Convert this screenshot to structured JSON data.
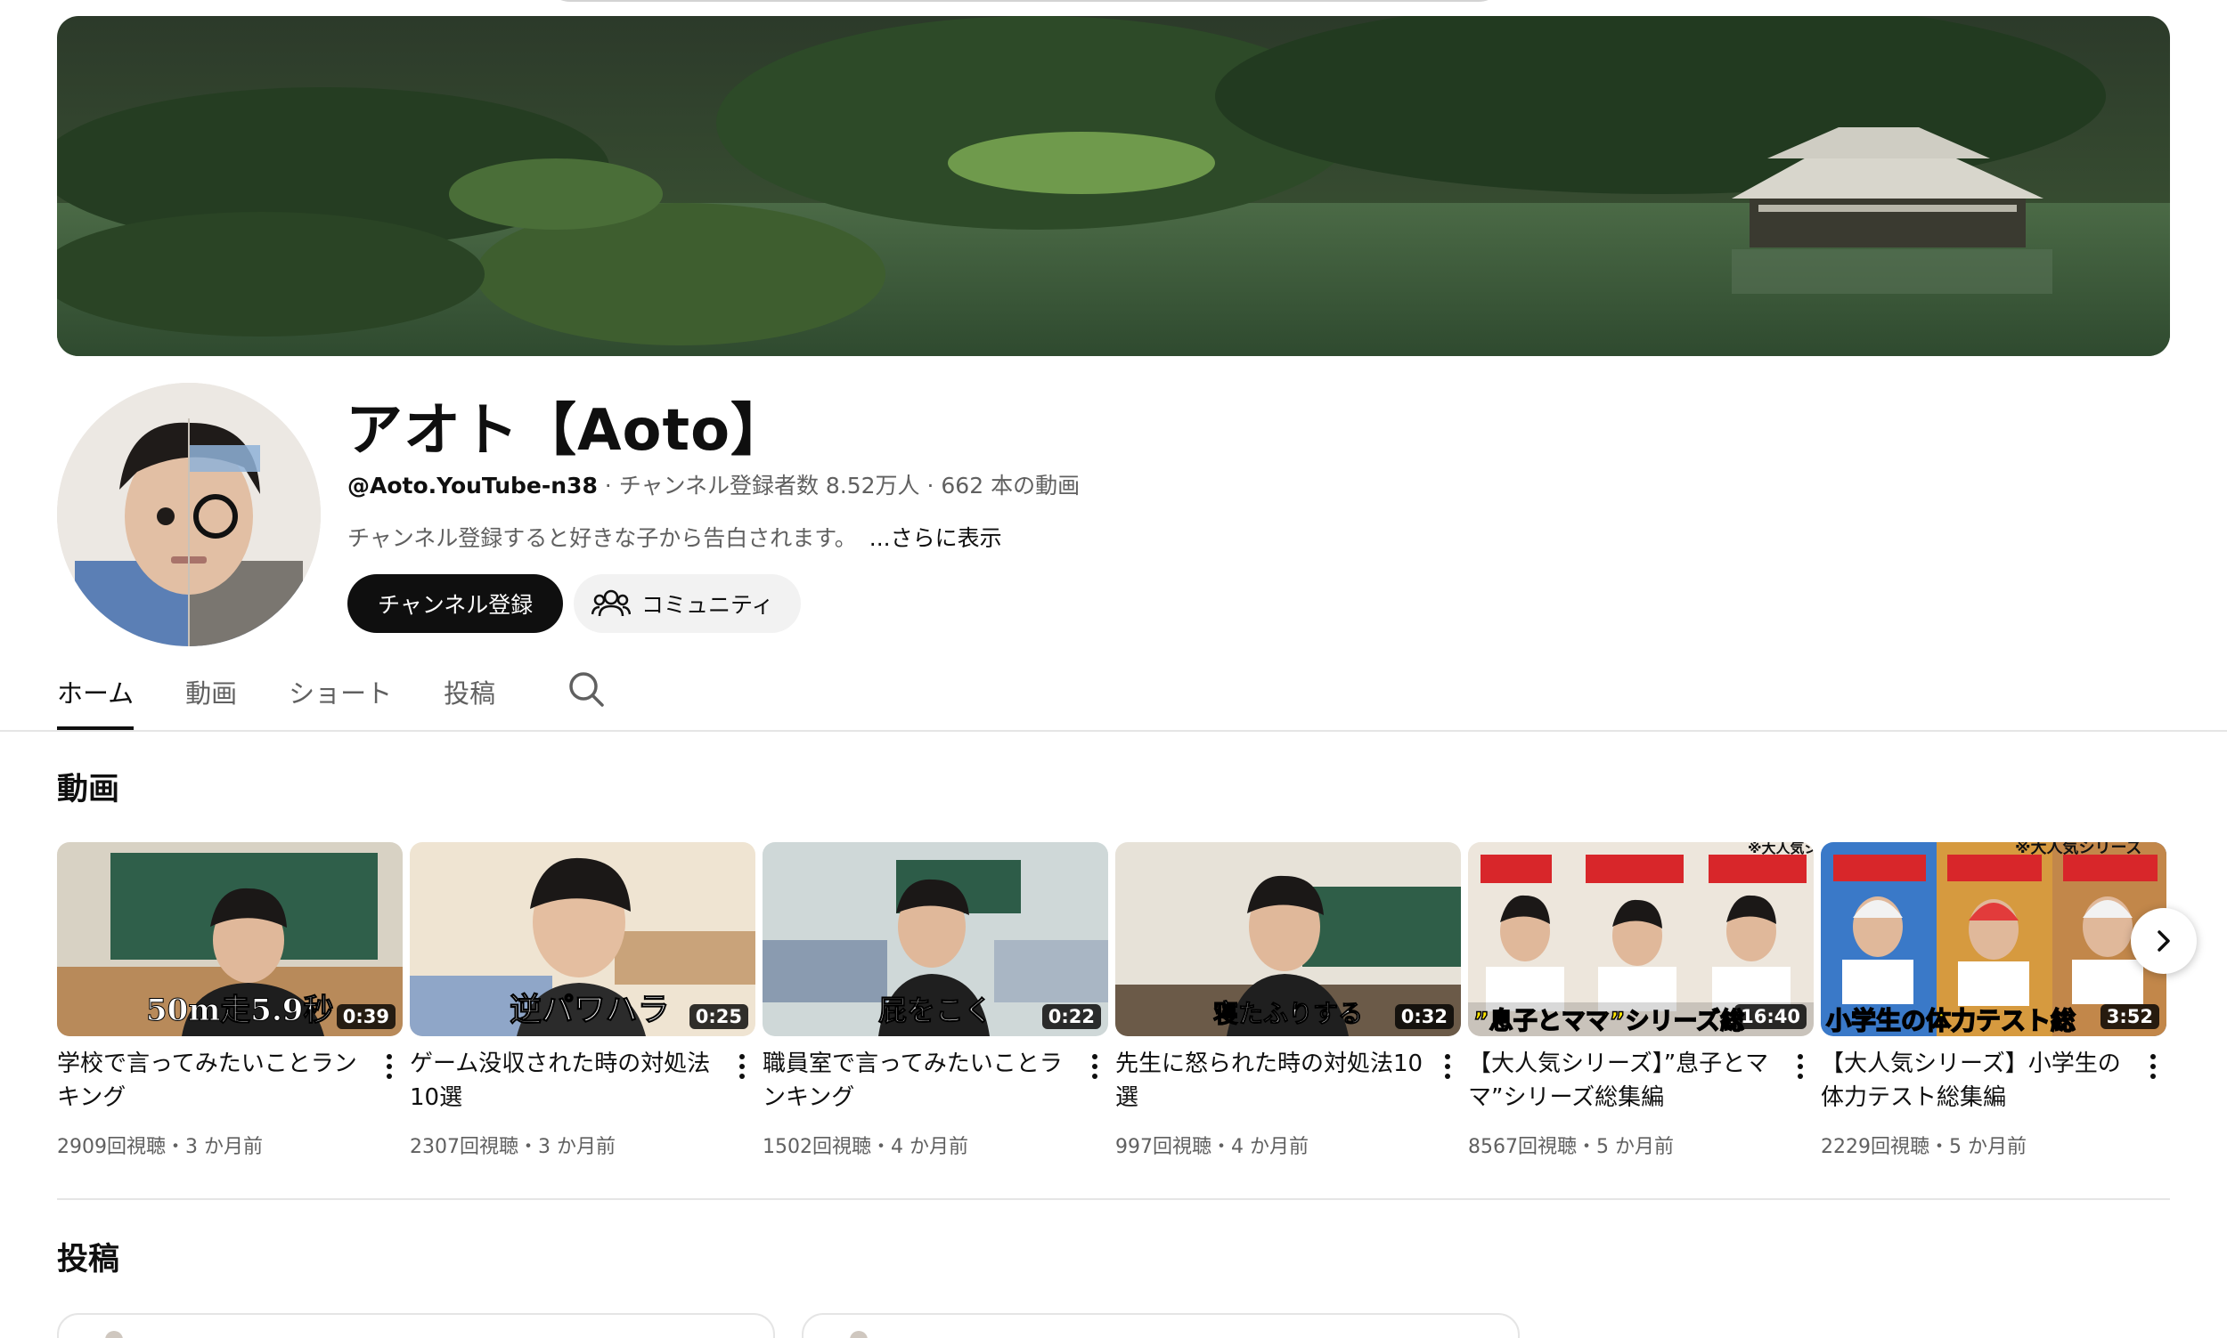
{
  "channel": {
    "name": "アオト【Aoto】",
    "handle": "@Aoto.YouTube-n38",
    "meta_rest": " · チャンネル登録者数 8.52万人 · 662 本の動画",
    "description": "チャンネル登録すると好きな子から告白されます。",
    "more_label": "...さらに表示",
    "subscribe_label": "チャンネル登録",
    "community_label": "コミュニティ"
  },
  "tabs": [
    {
      "label": "ホーム",
      "active": true
    },
    {
      "label": "動画",
      "active": false
    },
    {
      "label": "ショート",
      "active": false
    },
    {
      "label": "投稿",
      "active": false
    }
  ],
  "sections": {
    "videos_title": "動画",
    "posts_title": "投稿"
  },
  "videos": [
    {
      "title": "学校で言ってみたいことランキング",
      "stats": "2909回視聴・3 か月前",
      "duration": "0:39",
      "caption": "50m走5.9秒"
    },
    {
      "title": "ゲーム没収された時の対処法10選",
      "stats": "2307回視聴・3 か月前",
      "duration": "0:25",
      "caption": "逆パワハラ"
    },
    {
      "title": "職員室で言ってみたいことランキング",
      "stats": "1502回視聴・4 か月前",
      "duration": "0:22",
      "caption": "屁をこく"
    },
    {
      "title": "先生に怒られた時の対処法10選",
      "stats": "997回視聴・4 か月前",
      "duration": "0:32",
      "caption": "寝たふりする"
    },
    {
      "title": "【大人気シリーズ】”息子とママ”シリーズ総集編",
      "stats": "8567回視聴・5 か月前",
      "duration": "16:40",
      "caption": "”息子とママ”シリーズ総",
      "badge": "※大人気シリーズ"
    },
    {
      "title": "【大人気シリーズ】小学生の体力テスト総集編",
      "stats": "2229回視聴・5 か月前",
      "duration": "3:52",
      "caption": "小学生の体力テスト総",
      "badge": "※大人気シリーズ"
    }
  ],
  "icons": {
    "community": "people-icon",
    "search": "search-icon",
    "next": "chevron-right-icon",
    "video_menu": "more-vert-icon"
  },
  "colors": {
    "subscribe_bg": "#0f0f0f",
    "secondary_text": "#606060",
    "caption_yellow": "#ffe600"
  }
}
